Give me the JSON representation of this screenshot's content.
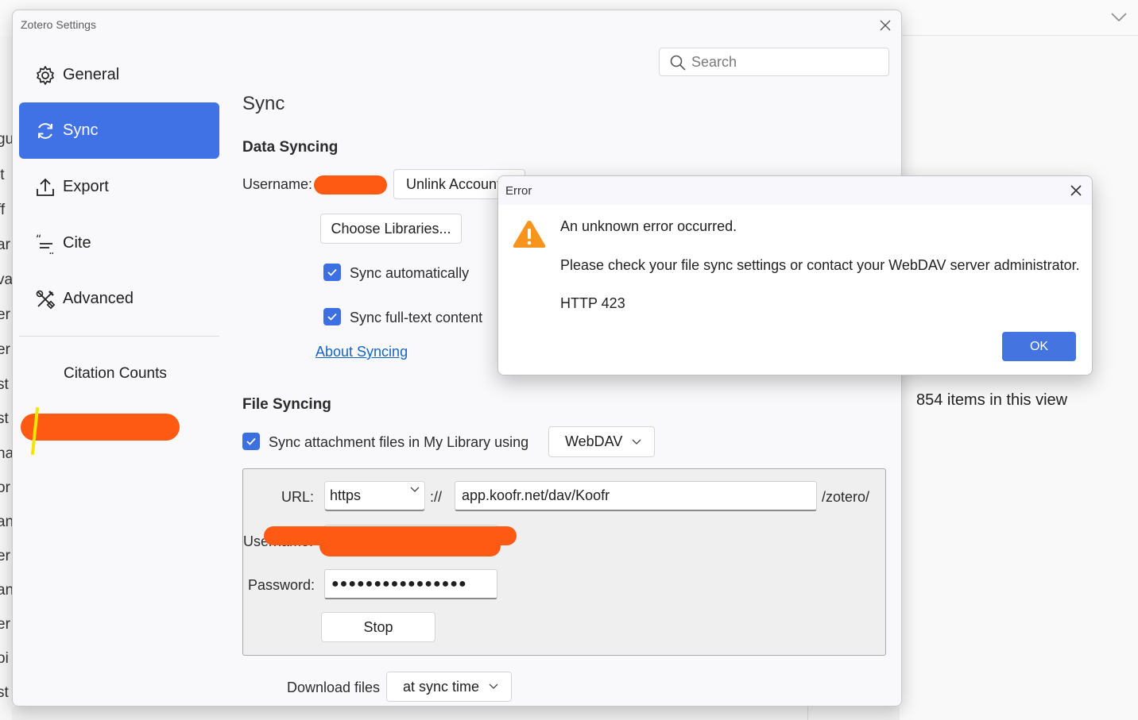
{
  "background": {
    "items_count": "854 items in this view",
    "left_fragments": [
      "gu",
      "lt",
      "ff",
      "ar",
      "va",
      "er",
      "er",
      "st",
      "st",
      "na",
      "or",
      "an",
      "er",
      "an",
      "er",
      "oi",
      "st"
    ]
  },
  "settings": {
    "title": "Zotero Settings",
    "search_placeholder": "Search",
    "nav": {
      "general": "General",
      "sync": "Sync",
      "export": "Export",
      "cite": "Cite",
      "advanced": "Advanced",
      "citation_counts": "Citation Counts"
    },
    "pane_title": "Sync",
    "data_syncing": {
      "heading": "Data Syncing",
      "username_label": "Username:",
      "unlink_button": "Unlink Account",
      "choose_libraries_button": "Choose Libraries...",
      "sync_automatically": "Sync automatically",
      "sync_full_text": "Sync full-text content",
      "about_link": "About Syncing"
    },
    "file_syncing": {
      "heading": "File Syncing",
      "sync_attachments_label": "Sync attachment files in My Library using",
      "method": "WebDAV",
      "url_label": "URL:",
      "protocol": "https",
      "separator": "://",
      "url_value": "app.koofr.net/dav/Koofr",
      "url_suffix": "/zotero/",
      "username_label": "Username:",
      "password_label": "Password:",
      "password_value": "●●●●●●●●●●●●●●●●",
      "stop_button": "Stop",
      "download_label": "Download files",
      "download_value": "at sync time"
    }
  },
  "error_dialog": {
    "title": "Error",
    "line1": "An unknown error occurred.",
    "line2": "Please check your file sync settings or contact your WebDAV server administrator.",
    "line3": "HTTP 423",
    "ok_button": "OK"
  },
  "colors": {
    "accent": "#4072e5",
    "ok_button": "#4374e0",
    "warning": "#f7941d",
    "redaction": "#ff5a14",
    "link": "#1565c0"
  },
  "icons": {
    "general": "gear-icon",
    "sync": "sync-icon",
    "export": "export-icon",
    "cite": "cite-icon",
    "advanced": "tools-icon",
    "search": "search-icon",
    "warning": "warning-icon",
    "close": "close-icon"
  }
}
